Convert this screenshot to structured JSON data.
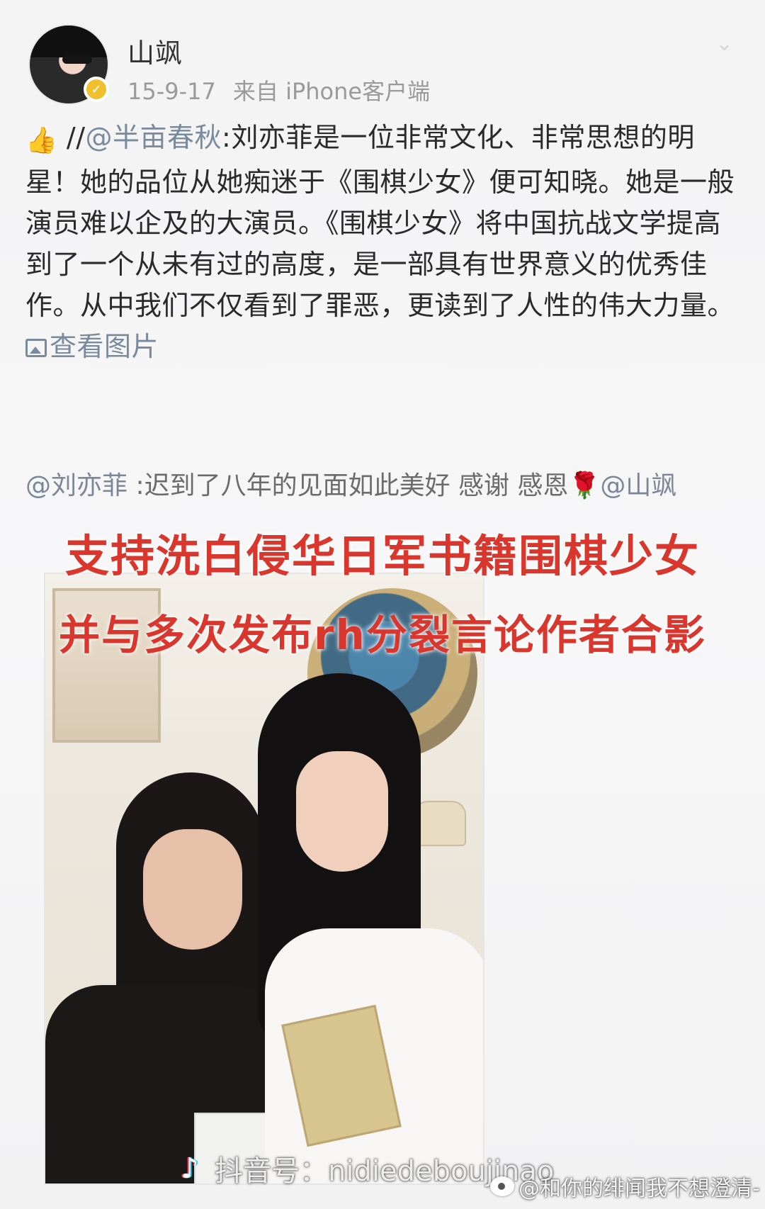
{
  "post": {
    "username": "山飒",
    "date": "15-9-17",
    "source": "来自 iPhone客户端",
    "body": {
      "prefix": "//",
      "mention": "@半亩春秋",
      "text": ":刘亦菲是一位非常文化、非常思想的明星！她的品位从她痴迷于《围棋少女》便可知晓。她是一般演员难以企及的大演员。《围棋少女》将中国抗战文学提高到了一个从未有过的高度，是一部具有世界意义的优秀佳作。从中我们不仅看到了罪恶，更读到了人性的伟大力量。",
      "view_image_label": "查看图片"
    },
    "repost": {
      "mention": "@刘亦菲",
      "text": " :迟到了八年的见面如此美好 感谢 感恩🌹",
      "mention_tail": "@山飒"
    }
  },
  "overlay": {
    "caption_line1": "支持洗白侵华日军书籍围棋少女",
    "caption_line2": "并与多次发布rh分裂言论作者合影"
  },
  "watermarks": {
    "douyin_text": "抖音号：nidiedeboujinao",
    "weibo_text": "@和你的绯闻我不想澄清-"
  },
  "colors": {
    "accent_link": "#7a8a9d",
    "caption_red": "#d9372e",
    "verified_gold": "#f1c02e"
  },
  "icons": {
    "thumbs": "thumbs-up-icon",
    "verified": "verified-badge-icon",
    "view_image": "image-icon",
    "douyin": "douyin-logo-icon",
    "weibo": "weibo-logo-icon"
  }
}
